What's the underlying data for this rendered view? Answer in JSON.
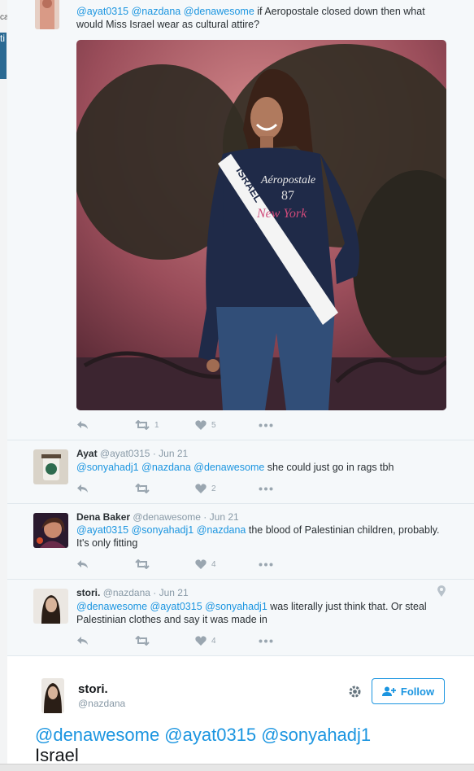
{
  "background": {
    "edge_text": "ca",
    "strip_text": "ti"
  },
  "colors": {
    "mention": "#1b95e0",
    "meta": "#8899a6",
    "thread_bg": "#f5f8fa",
    "action_icon": "#9aa6b0"
  },
  "thread": {
    "tweets": [
      {
        "avatar_icon": "user-avatar-photo",
        "mentions": [
          "@ayat0315",
          "@nazdana",
          "@denawesome"
        ],
        "text_line1": "if Aeropostale closed down then what",
        "text_line2": "would Miss Israel wear as cultural attire?",
        "media": {
          "sash_text": "ISRAEL",
          "hoodie_text1": "Aéropostale",
          "hoodie_text2": "87",
          "hoodie_text3": "New York"
        },
        "retweets": "1",
        "likes": "5"
      },
      {
        "name": "Ayat",
        "handle": "@ayat0315",
        "date": "Jun 21",
        "mentions": [
          "@sonyahadj1",
          "@nazdana",
          "@denawesome"
        ],
        "text": "she could just go in rags tbh",
        "retweets": "",
        "likes": "2"
      },
      {
        "name": "Dena Baker",
        "handle": "@denawesome",
        "date": "Jun 21",
        "mentions": [
          "@ayat0315",
          "@sonyahadj1",
          "@nazdana"
        ],
        "text_line1": "the blood of Palestinian children, probably.",
        "text_line2": "It's only fitting",
        "retweets": "",
        "likes": "4"
      },
      {
        "name": "stori.",
        "handle": "@nazdana",
        "date": "Jun 21",
        "mentions": [
          "@denawesome",
          "@ayat0315",
          "@sonyahadj1"
        ],
        "text_line1": "was literally just think that. Or steal",
        "text_line2": "Palestinian clothes and say it was made in",
        "retweets": "",
        "likes": "4"
      }
    ]
  },
  "main_tweet": {
    "name": "stori.",
    "handle": "@nazdana",
    "follow_label": "Follow",
    "mentions_line": "@denawesome @ayat0315 @sonyahadj1",
    "text_line2": "Israel"
  }
}
